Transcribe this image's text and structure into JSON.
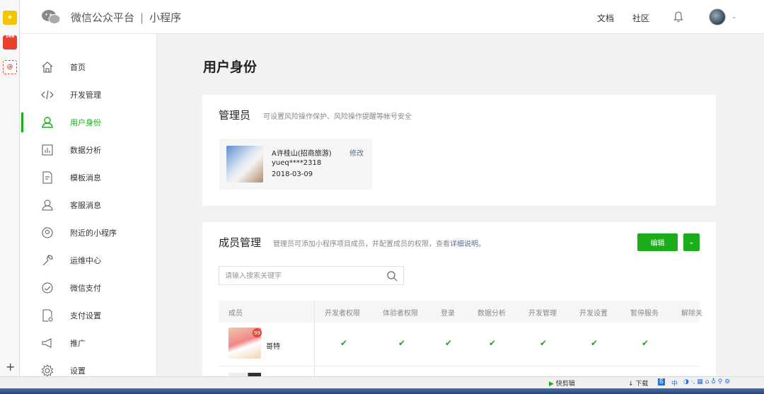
{
  "rail": {
    "badge_count": "166"
  },
  "header": {
    "brand_main": "微信公众平台",
    "brand_separator": "|",
    "brand_sub": "小程序",
    "links": [
      "文档",
      "社区"
    ]
  },
  "sidebar": {
    "items": [
      {
        "label": "首页",
        "icon": "home-icon"
      },
      {
        "label": "开发管理",
        "icon": "code-icon"
      },
      {
        "label": "用户身份",
        "icon": "user-icon",
        "active": true
      },
      {
        "label": "数据分析",
        "icon": "bar-chart-icon"
      },
      {
        "label": "模板消息",
        "icon": "document-icon"
      },
      {
        "label": "客服消息",
        "icon": "customer-service-icon"
      },
      {
        "label": "附近的小程序",
        "icon": "location-icon"
      },
      {
        "label": "运维中心",
        "icon": "wrench-icon"
      },
      {
        "label": "微信支付",
        "icon": "pay-icon"
      },
      {
        "label": "支付设置",
        "icon": "payment-settings-icon"
      },
      {
        "label": "推广",
        "icon": "megaphone-icon"
      },
      {
        "label": "设置",
        "icon": "gear-icon"
      }
    ]
  },
  "main": {
    "page_title": "用户身份",
    "admin": {
      "title": "管理员",
      "desc": "可设置风险操作保护、风险操作提醒等帐号安全",
      "name": "A许桂山(招商旅游)",
      "edit_label": "修改",
      "wechat_id": "yueq****2318",
      "date": "2018-03-09"
    },
    "members": {
      "title": "成员管理",
      "desc": "管理员可添加小程序项目成员，并配置成员的权限，查看",
      "desc_link": "详细说明。",
      "edit_button": "编辑",
      "search_placeholder": "请输入搜索关键字",
      "columns": [
        "成员",
        "开发者权限",
        "体验者权限",
        "登录",
        "数据分析",
        "开发管理",
        "开发设置",
        "暂停服务",
        "解除关"
      ],
      "rows": [
        {
          "name": "哥特",
          "badge": "99",
          "checks": [
            "✔",
            "✔",
            "✔",
            "✔",
            "✔",
            "✔",
            "✔"
          ]
        }
      ]
    }
  },
  "ime": {
    "quick_clip": "快剪辑",
    "download": "下载",
    "lang": "中"
  },
  "colors": {
    "accent": "#1aad19",
    "link": "#576b95"
  }
}
